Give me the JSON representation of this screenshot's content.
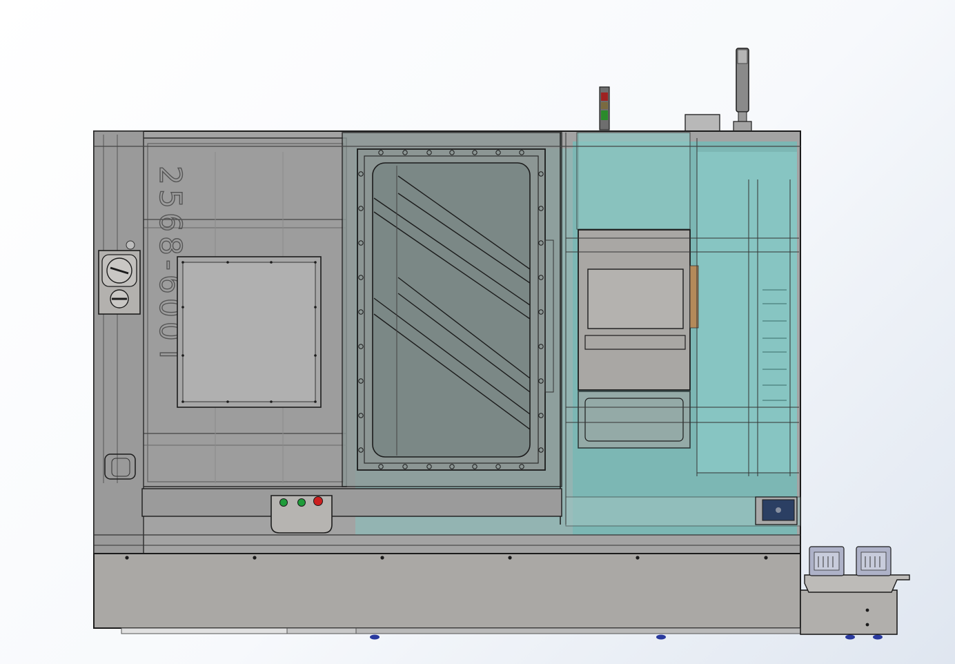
{
  "model": {
    "label": "2568-600T",
    "colors": {
      "frame": "#9c9c9c",
      "frame_dark": "#7f7f7f",
      "base": "#a8a6a3",
      "glass": "#7a8784",
      "cyan_area": "#7cc0bd",
      "outline": "#1b1b1b",
      "panel_light": "#b2b0ad",
      "button_green": "#1f9c3a",
      "button_red": "#cc1f1f",
      "motor_blue": "#2b3f63",
      "feet_blue": "#2a3a9e",
      "lamp_red": "#9e2222",
      "lamp_green": "#2b8a2b"
    },
    "icons": {
      "control_panel": "button-panel-icon",
      "signal_tower": "signal-tower-icon",
      "motor": "motor-icon",
      "dial": "dial-icon"
    }
  }
}
